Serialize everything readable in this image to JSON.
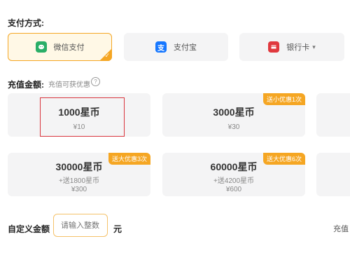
{
  "payment": {
    "title": "支付方式:",
    "options": [
      {
        "label": "微信支付",
        "icon": "wechat-pay-icon",
        "selected": true
      },
      {
        "label": "支付宝",
        "icon": "alipay-icon",
        "selected": false
      },
      {
        "label": "银行卡",
        "icon": "bank-card-icon",
        "selected": false
      }
    ],
    "alipay_glyph": "支",
    "check_glyph": "✓",
    "dropdown_glyph": "▾"
  },
  "recharge": {
    "title": "充值金额:",
    "hint": "充值可获优惠",
    "help_glyph": "?",
    "cards": [
      {
        "amount": "1000星币",
        "bonus": "",
        "price": "¥10",
        "badge": ""
      },
      {
        "amount": "3000星币",
        "bonus": "",
        "price": "¥30",
        "badge": "送小优惠1次"
      },
      {
        "amount": "30000星币",
        "bonus": "+送1800星币",
        "price": "¥300",
        "badge": "送大优惠3次"
      },
      {
        "amount": "60000星币",
        "bonus": "+送4200星币",
        "price": "¥600",
        "badge": "送大优惠6次"
      }
    ]
  },
  "custom": {
    "label": "自定义金额",
    "placeholder": "请输入整数",
    "unit": "元",
    "right_text": "充值"
  },
  "colors": {
    "accent": "#f5a623",
    "wechat": "#2aae67",
    "alipay": "#1677ff",
    "bank": "#e0393e",
    "highlight": "#d9363e"
  }
}
